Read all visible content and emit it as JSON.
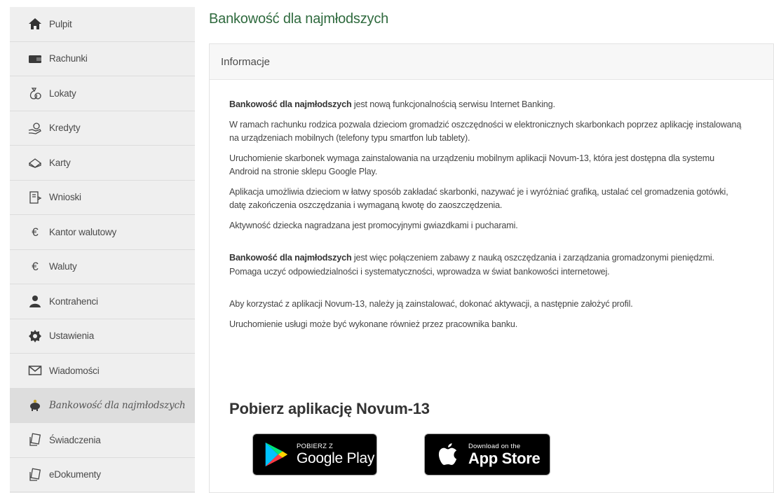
{
  "sidebar": {
    "items": [
      {
        "label": "Pulpit",
        "icon": "home-icon"
      },
      {
        "label": "Rachunki",
        "icon": "wallet-icon"
      },
      {
        "label": "Lokaty",
        "icon": "money-bag-icon"
      },
      {
        "label": "Kredyty",
        "icon": "credit-hand-icon"
      },
      {
        "label": "Karty",
        "icon": "card-icon"
      },
      {
        "label": "Wnioski",
        "icon": "document-icon"
      },
      {
        "label": "Kantor walutowy",
        "icon": "euro-icon"
      },
      {
        "label": "Waluty",
        "icon": "euro-icon"
      },
      {
        "label": "Kontrahenci",
        "icon": "user-icon"
      },
      {
        "label": "Ustawienia",
        "icon": "gear-icon"
      },
      {
        "label": "Wiadomości",
        "icon": "envelope-icon"
      },
      {
        "label": "Bankowość dla najmłodszych",
        "icon": "piggy-bank-icon",
        "active": true
      },
      {
        "label": "Świadczenia",
        "icon": "stack-icon"
      },
      {
        "label": "eDokumenty",
        "icon": "stack-icon"
      }
    ]
  },
  "main": {
    "title": "Bankowość dla najmłodszych",
    "panel_header": "Informacje",
    "p1_bold": "Bankowość dla najmłodszych",
    "p1_rest": " jest nową funkcjonalnością serwisu Internet Banking.",
    "p2": "W ramach rachunku rodzica pozwala dzieciom gromadzić oszczędności w elektronicznych skarbonkach poprzez aplikację instalowaną na urządzeniach mobilnych (telefony typu smartfon lub tablety).",
    "p3": "Uruchomienie skarbonek wymaga zainstalowania na urządzeniu mobilnym aplikacji Novum-13, która jest dostępna dla systemu Android na stronie sklepu Google Play.",
    "p4": "Aplikacja umożliwia dzieciom w łatwy sposób zakładać skarbonki, nazywać je i wyróżniać grafiką, ustalać cel gromadzenia gotówki, datę zakończenia oszczędzania i wymaganą kwotę do zaoszczędzenia.",
    "p5": "Aktywność dziecka nagradzana jest promocyjnymi gwiazdkami i pucharami.",
    "p6_bold": "Bankowość dla najmłodszych",
    "p6_rest": " jest więc połączeniem zabawy z nauką oszczędzania i zarządzania gromadzonymi pieniędzmi. Pomaga uczyć odpowiedzialności i systematyczności, wprowadza w świat bankowości internetowej.",
    "p7": "Aby korzystać z aplikacji Novum-13, należy ją zainstalować, dokonać aktywacji, a następnie założyć profil.",
    "p8": "Uruchomienie usługi może być wykonane również przez pracownika banku.",
    "download_title": "Pobierz aplikację Novum-13",
    "google_play": {
      "small": "POBIERZ Z",
      "big": "Google Play"
    },
    "app_store": {
      "small": "Download on the",
      "big": "App Store"
    }
  },
  "colors": {
    "accent_title": "#2f6a3e",
    "sidebar_bg": "#efefef",
    "active_bg": "#dddddd"
  }
}
